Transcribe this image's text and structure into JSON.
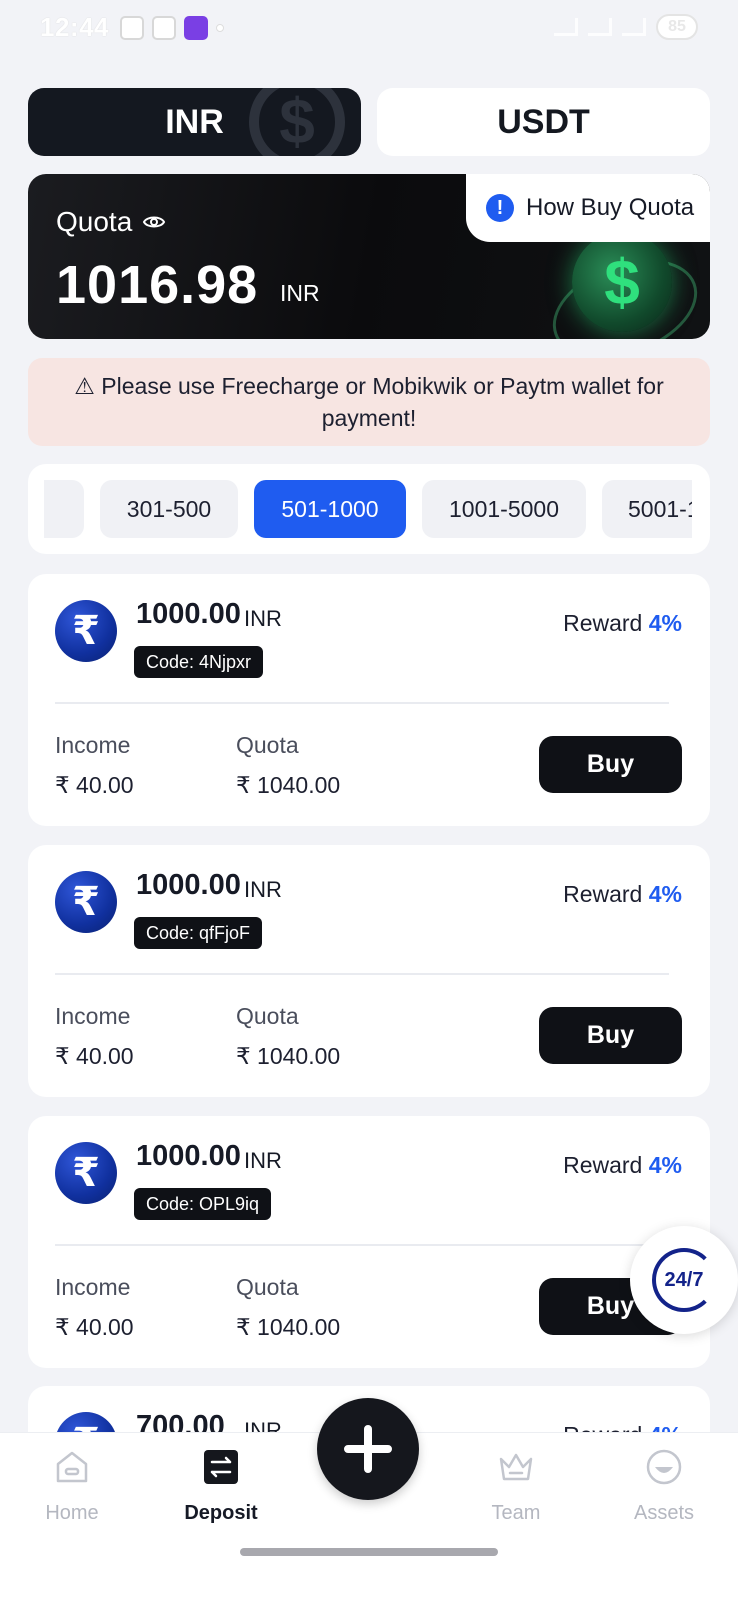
{
  "status_bar": {
    "time": "12:44",
    "battery": "85"
  },
  "currency_tabs": [
    {
      "label": "INR",
      "active": true
    },
    {
      "label": "USDT",
      "active": false
    }
  ],
  "quota_banner": {
    "label": "Quota",
    "amount": "1016.98",
    "unit": "INR",
    "how_buy_label": "How Buy Quota",
    "info_icon": "!"
  },
  "notice": {
    "icon": "⚠",
    "text": "Please use Freecharge or Mobikwik or Paytm wallet for payment!"
  },
  "range_tabs": [
    {
      "label": "",
      "active": false
    },
    {
      "label": "301-500",
      "active": false
    },
    {
      "label": "501-1000",
      "active": true
    },
    {
      "label": "1001-5000",
      "active": false
    },
    {
      "label": "5001-1",
      "active": false
    }
  ],
  "offers": [
    {
      "amount": "1000.00",
      "unit": "INR",
      "code": "Code: 4Njpxr",
      "reward_label": "Reward",
      "reward_pct": "4%",
      "income_label": "Income",
      "income_value": "₹ 40.00",
      "quota_label": "Quota",
      "quota_value": "₹ 1040.00",
      "buy_label": "Buy"
    },
    {
      "amount": "1000.00",
      "unit": "INR",
      "code": "Code: qfFjoF",
      "reward_label": "Reward",
      "reward_pct": "4%",
      "income_label": "Income",
      "income_value": "₹ 40.00",
      "quota_label": "Quota",
      "quota_value": "₹ 1040.00",
      "buy_label": "Buy"
    },
    {
      "amount": "1000.00",
      "unit": "INR",
      "code": "Code: OPL9iq",
      "reward_label": "Reward",
      "reward_pct": "4%",
      "income_label": "Income",
      "income_value": "₹ 40.00",
      "quota_label": "Quota",
      "quota_value": "₹ 1040.00",
      "buy_label": "Buy"
    },
    {
      "amount": "700.00",
      "unit": "INR",
      "code": "",
      "reward_label": "Reward",
      "reward_pct": "4%",
      "income_label": "",
      "income_value": "",
      "quota_label": "",
      "quota_value": "",
      "buy_label": ""
    }
  ],
  "support": {
    "label": "24/7"
  },
  "bottom_nav": [
    {
      "label": "Home",
      "icon": "home-icon",
      "active": false
    },
    {
      "label": "Deposit",
      "icon": "exchange-icon",
      "active": true
    },
    {
      "label": "Team",
      "icon": "crown-icon",
      "active": false
    },
    {
      "label": "Assets",
      "icon": "wallet-icon",
      "active": false
    }
  ],
  "colors": {
    "accent_blue": "#1f5cf0",
    "dark": "#141820",
    "notice_bg": "#f7e5e2",
    "page_bg": "#f2f3f7"
  }
}
